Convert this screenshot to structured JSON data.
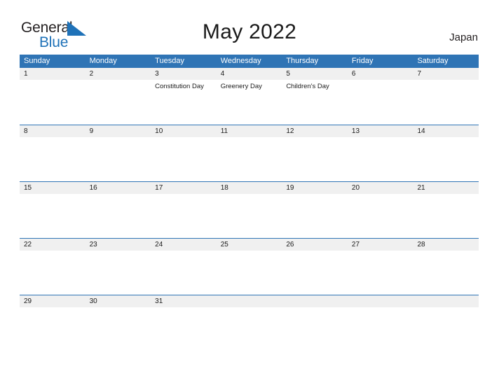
{
  "brand": {
    "name_part1": "General",
    "name_part2": "Blue",
    "flag_icon": "flag-triangle-icon",
    "accent_color": "#1f72b8"
  },
  "header": {
    "title": "May 2022",
    "country": "Japan"
  },
  "calendar": {
    "header_bg": "#2f74b5",
    "band_bg": "#f0f0f0",
    "day_names": [
      "Sunday",
      "Monday",
      "Tuesday",
      "Wednesday",
      "Thursday",
      "Friday",
      "Saturday"
    ],
    "weeks": [
      [
        {
          "day": "1",
          "event": ""
        },
        {
          "day": "2",
          "event": ""
        },
        {
          "day": "3",
          "event": "Constitution Day"
        },
        {
          "day": "4",
          "event": "Greenery Day"
        },
        {
          "day": "5",
          "event": "Children's Day"
        },
        {
          "day": "6",
          "event": ""
        },
        {
          "day": "7",
          "event": ""
        }
      ],
      [
        {
          "day": "8",
          "event": ""
        },
        {
          "day": "9",
          "event": ""
        },
        {
          "day": "10",
          "event": ""
        },
        {
          "day": "11",
          "event": ""
        },
        {
          "day": "12",
          "event": ""
        },
        {
          "day": "13",
          "event": ""
        },
        {
          "day": "14",
          "event": ""
        }
      ],
      [
        {
          "day": "15",
          "event": ""
        },
        {
          "day": "16",
          "event": ""
        },
        {
          "day": "17",
          "event": ""
        },
        {
          "day": "18",
          "event": ""
        },
        {
          "day": "19",
          "event": ""
        },
        {
          "day": "20",
          "event": ""
        },
        {
          "day": "21",
          "event": ""
        }
      ],
      [
        {
          "day": "22",
          "event": ""
        },
        {
          "day": "23",
          "event": ""
        },
        {
          "day": "24",
          "event": ""
        },
        {
          "day": "25",
          "event": ""
        },
        {
          "day": "26",
          "event": ""
        },
        {
          "day": "27",
          "event": ""
        },
        {
          "day": "28",
          "event": ""
        }
      ],
      [
        {
          "day": "29",
          "event": ""
        },
        {
          "day": "30",
          "event": ""
        },
        {
          "day": "31",
          "event": ""
        },
        {
          "day": "",
          "event": ""
        },
        {
          "day": "",
          "event": ""
        },
        {
          "day": "",
          "event": ""
        },
        {
          "day": "",
          "event": ""
        }
      ]
    ]
  }
}
